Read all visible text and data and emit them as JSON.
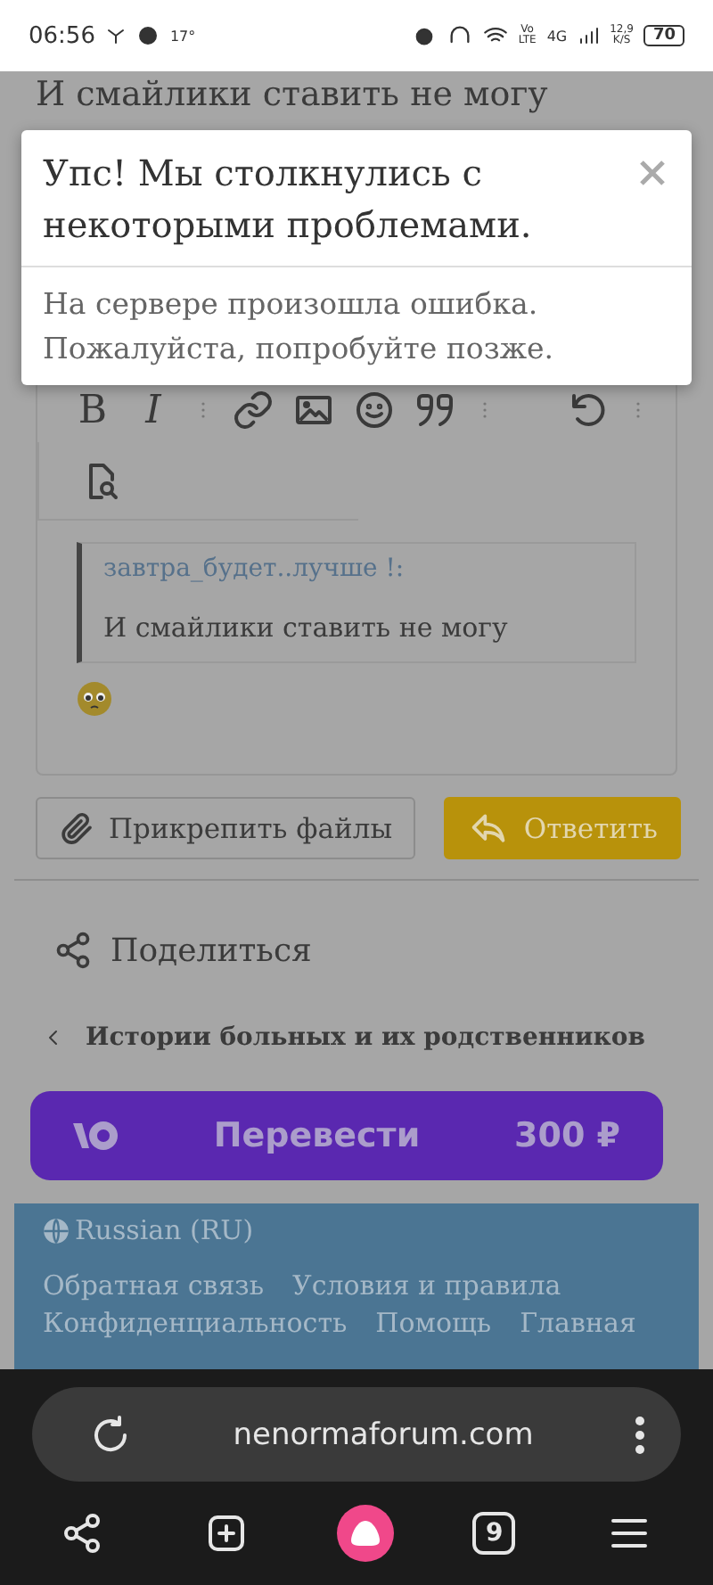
{
  "status_bar": {
    "time": "06:56",
    "temperature": "17°",
    "volte_top": "Vo",
    "volte_bottom": "LTE",
    "network": "4G",
    "speed": "12,9",
    "speed_unit": "K/S",
    "battery": "70"
  },
  "background_text": "И смайлики ставить не могу",
  "dialog": {
    "title": "Упс! Мы столкнулись с некоторыми проблемами.",
    "message": "На сервере произошла ошибка. Пожалуйста, попробуйте позже."
  },
  "editor": {
    "toolbar": [
      {
        "kind": "bold",
        "label": "B"
      },
      {
        "kind": "italic",
        "label": "I"
      },
      {
        "kind": "more"
      },
      {
        "kind": "link"
      },
      {
        "kind": "image"
      },
      {
        "kind": "smile"
      },
      {
        "kind": "quote"
      },
      {
        "kind": "more"
      },
      {
        "kind": "gap"
      },
      {
        "kind": "undo"
      },
      {
        "kind": "more"
      }
    ],
    "quote": {
      "author": "завтра_будет..лучше !:",
      "text": "И смайлики ставить не могу"
    }
  },
  "actions": [
    {
      "kind": "attach",
      "label": "Прикрепить файлы"
    },
    {
      "kind": "reply",
      "label": "Ответить"
    }
  ],
  "share": {
    "label": "Поделиться"
  },
  "breadcrumb": {
    "label": "Истории больных и их родственников"
  },
  "donate": {
    "label": "Перевести",
    "amount": "300 ₽"
  },
  "footer": {
    "language": "Russian (RU)",
    "links": [
      "Обратная связь",
      "Условия и правила",
      "Конфиденциальность",
      "Помощь",
      "Главная"
    ]
  },
  "browser": {
    "url": "nenormaforum.com",
    "tab_count": "9"
  }
}
